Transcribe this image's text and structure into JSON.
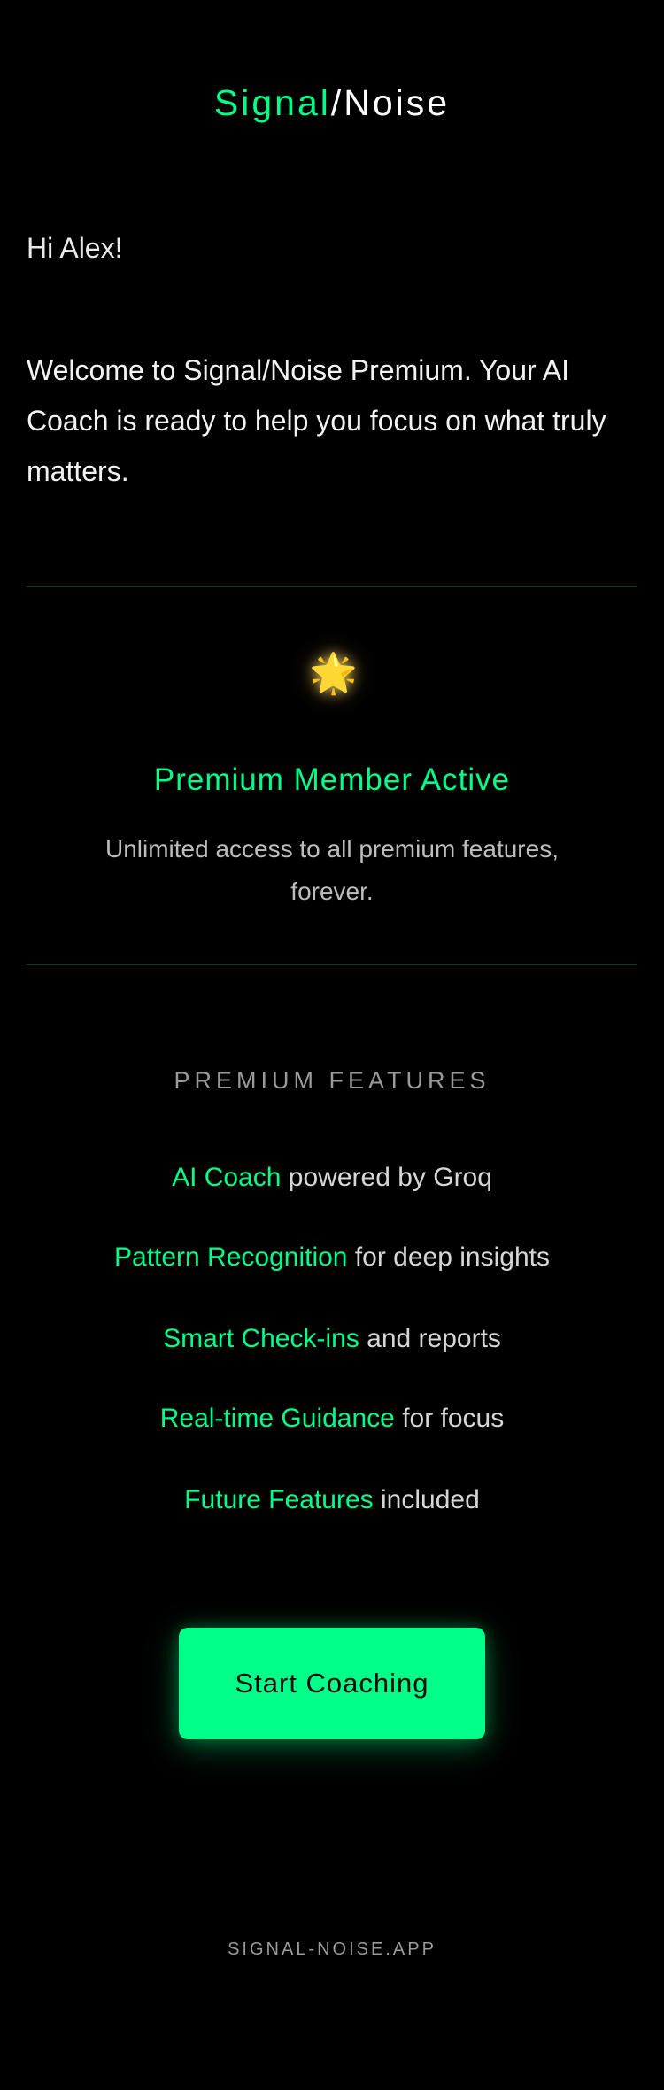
{
  "brand": {
    "accent": "Signal",
    "rest": "/Noise"
  },
  "greeting": "Hi Alex!",
  "intro": "Welcome to Signal/Noise Premium. Your AI Coach is ready to help you focus on what truly matters.",
  "premium": {
    "icon": "glowing-star-icon",
    "icon_glyph": "🌟",
    "title": "Premium Member Active",
    "subtitle": "Unlimited access to all premium features, forever."
  },
  "features": {
    "heading": "PREMIUM FEATURES",
    "items": [
      {
        "highlight": "AI Coach",
        "rest": " powered by Groq"
      },
      {
        "highlight": "Pattern Recognition",
        "rest": " for deep insights"
      },
      {
        "highlight": "Smart Check-ins",
        "rest": " and reports"
      },
      {
        "highlight": "Real-time Guidance",
        "rest": " for focus"
      },
      {
        "highlight": "Future Features",
        "rest": " included"
      }
    ]
  },
  "cta": {
    "label": "Start Coaching"
  },
  "footer": {
    "link": "SIGNAL-NOISE.APP"
  },
  "colors": {
    "accent": "#00ff88",
    "background": "#000000",
    "divider": "#0f3a26"
  }
}
